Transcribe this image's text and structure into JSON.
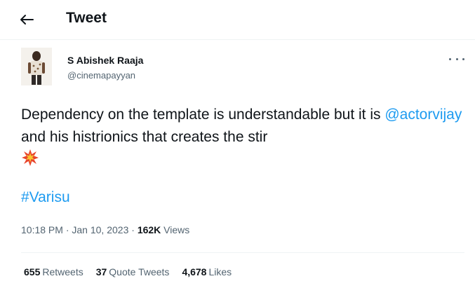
{
  "header": {
    "title": "Tweet",
    "back_icon": "arrow-left-icon"
  },
  "author": {
    "display_name": "S Abishek Raaja",
    "handle": "@cinemapayyan",
    "avatar_icon": "avatar-photo"
  },
  "tweet": {
    "text_before": "Dependency on the template is understandable but it is ",
    "mention": "@actorvijay",
    "text_after": " and his histrionics that creates the stir",
    "emoji_icon": "collision-emoji-icon",
    "hashtag": "#Varisu"
  },
  "meta": {
    "time": "10:18 PM",
    "separator": "·",
    "date": "Jan 10, 2023",
    "views_count": "162K",
    "views_label": "Views"
  },
  "stats": {
    "retweets_count": "655",
    "retweets_label": "Retweets",
    "quotes_count": "37",
    "quotes_label": "Quote Tweets",
    "likes_count": "4,678",
    "likes_label": "Likes"
  },
  "colors": {
    "link": "#1d9bf0",
    "secondary": "#536471",
    "primary": "#0f1419"
  }
}
